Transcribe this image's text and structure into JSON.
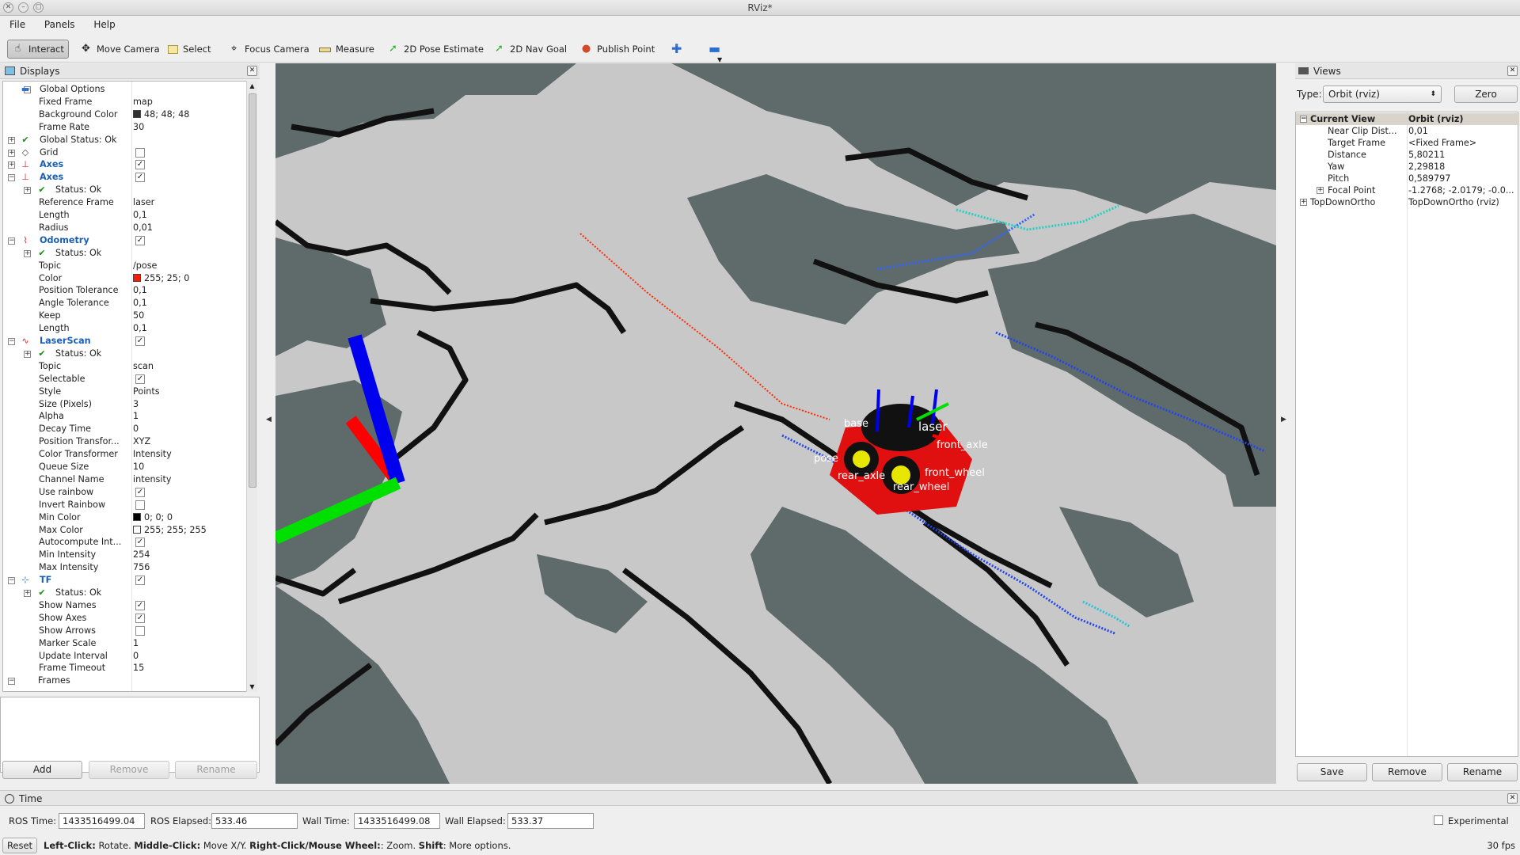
{
  "window": {
    "title": "RViz*"
  },
  "menu": [
    "File",
    "Panels",
    "Help"
  ],
  "toolbar": [
    {
      "label": "Interact",
      "icon": "hand-icon",
      "active": true
    },
    {
      "label": "Move Camera",
      "icon": "move-camera-icon"
    },
    {
      "label": "Select",
      "icon": "select-icon"
    },
    {
      "label": "Focus Camera",
      "icon": "focus-camera-icon"
    },
    {
      "label": "Measure",
      "icon": "measure-icon"
    },
    {
      "label": "2D Pose Estimate",
      "icon": "pose-arrow-icon"
    },
    {
      "label": "2D Nav Goal",
      "icon": "nav-goal-arrow-icon"
    },
    {
      "label": "Publish Point",
      "icon": "map-pin-icon"
    }
  ],
  "displays": {
    "title": "Displays",
    "rows": [
      {
        "name": "Global Options",
        "value": ""
      },
      {
        "name": "Fixed Frame",
        "value": "map"
      },
      {
        "name": "Background Color",
        "value": "48; 48; 48",
        "swatch": "#303030"
      },
      {
        "name": "Frame Rate",
        "value": "30"
      },
      {
        "name": "Global Status: Ok",
        "value": ""
      },
      {
        "name": "Grid",
        "value": ""
      },
      {
        "name": "Axes",
        "value": ""
      },
      {
        "name": "Axes",
        "value": ""
      },
      {
        "name": "Status: Ok",
        "value": ""
      },
      {
        "name": "Reference Frame",
        "value": "laser"
      },
      {
        "name": "Length",
        "value": "0,1"
      },
      {
        "name": "Radius",
        "value": "0,01"
      },
      {
        "name": "Odometry",
        "value": ""
      },
      {
        "name": "Status: Ok",
        "value": ""
      },
      {
        "name": "Topic",
        "value": "/pose"
      },
      {
        "name": "Color",
        "value": "255; 25; 0",
        "swatch": "#ff1900"
      },
      {
        "name": "Position Tolerance",
        "value": "0,1"
      },
      {
        "name": "Angle Tolerance",
        "value": "0,1"
      },
      {
        "name": "Keep",
        "value": "50"
      },
      {
        "name": "Length",
        "value": "0,1"
      },
      {
        "name": "LaserScan",
        "value": ""
      },
      {
        "name": "Status: Ok",
        "value": ""
      },
      {
        "name": "Topic",
        "value": "scan"
      },
      {
        "name": "Selectable",
        "value": ""
      },
      {
        "name": "Style",
        "value": "Points"
      },
      {
        "name": "Size (Pixels)",
        "value": "3"
      },
      {
        "name": "Alpha",
        "value": "1"
      },
      {
        "name": "Decay Time",
        "value": "0"
      },
      {
        "name": "Position Transfor...",
        "value": "XYZ"
      },
      {
        "name": "Color Transformer",
        "value": "Intensity"
      },
      {
        "name": "Queue Size",
        "value": "10"
      },
      {
        "name": "Channel Name",
        "value": "intensity"
      },
      {
        "name": "Use rainbow",
        "value": ""
      },
      {
        "name": "Invert Rainbow",
        "value": ""
      },
      {
        "name": "Min Color",
        "value": "0; 0; 0",
        "swatch": "#000000"
      },
      {
        "name": "Max Color",
        "value": "255; 255; 255",
        "swatch": "#ffffff"
      },
      {
        "name": "Autocompute Int...",
        "value": ""
      },
      {
        "name": "Min Intensity",
        "value": "254"
      },
      {
        "name": "Max Intensity",
        "value": "756"
      },
      {
        "name": "TF",
        "value": ""
      },
      {
        "name": "Status: Ok",
        "value": ""
      },
      {
        "name": "Show Names",
        "value": ""
      },
      {
        "name": "Show Axes",
        "value": ""
      },
      {
        "name": "Show Arrows",
        "value": ""
      },
      {
        "name": "Marker Scale",
        "value": "1"
      },
      {
        "name": "Update Interval",
        "value": "0"
      },
      {
        "name": "Frame Timeout",
        "value": "15"
      },
      {
        "name": "Frames",
        "value": ""
      }
    ],
    "add_label": "Add",
    "remove_label": "Remove",
    "rename_label": "Rename"
  },
  "viewport": {
    "labels": [
      "base",
      "laser",
      "front_axle",
      "rear_axle",
      "front_wheel",
      "rear_wheel",
      "pose"
    ]
  },
  "views": {
    "title": "Views",
    "type_label": "Type:",
    "type_value": "Orbit (rviz)",
    "zero_label": "Zero",
    "rows": [
      {
        "name": "Current View",
        "value": "Orbit (rviz)"
      },
      {
        "name": "Near Clip Dist...",
        "value": "0,01"
      },
      {
        "name": "Target Frame",
        "value": "<Fixed Frame>"
      },
      {
        "name": "Distance",
        "value": "5,80211"
      },
      {
        "name": "Yaw",
        "value": "2,29818"
      },
      {
        "name": "Pitch",
        "value": "0,589797"
      },
      {
        "name": "Focal Point",
        "value": "-1.2768; -2.0179; -0.0..."
      },
      {
        "name": "TopDownOrtho",
        "value": "TopDownOrtho (rviz)"
      }
    ],
    "save_label": "Save",
    "remove_label": "Remove",
    "rename_label": "Rename"
  },
  "time": {
    "title": "Time",
    "ros_time_label": "ROS Time:",
    "ros_time": "1433516499.04",
    "ros_elapsed_label": "ROS Elapsed:",
    "ros_elapsed": "533.46",
    "wall_time_label": "Wall Time:",
    "wall_time": "1433516499.08",
    "wall_elapsed_label": "Wall Elapsed:",
    "wall_elapsed": "533.37",
    "experimental_label": "Experimental"
  },
  "status": {
    "reset_label": "Reset",
    "hint_b1": "Left-Click:",
    "hint_t1": " Rotate. ",
    "hint_b2": "Middle-Click:",
    "hint_t2": " Move X/Y. ",
    "hint_b3": "Right-Click/Mouse Wheel:",
    "hint_t3": ": Zoom. ",
    "hint_b4": "Shift",
    "hint_t4": ": More options.",
    "fps": "30 fps"
  }
}
